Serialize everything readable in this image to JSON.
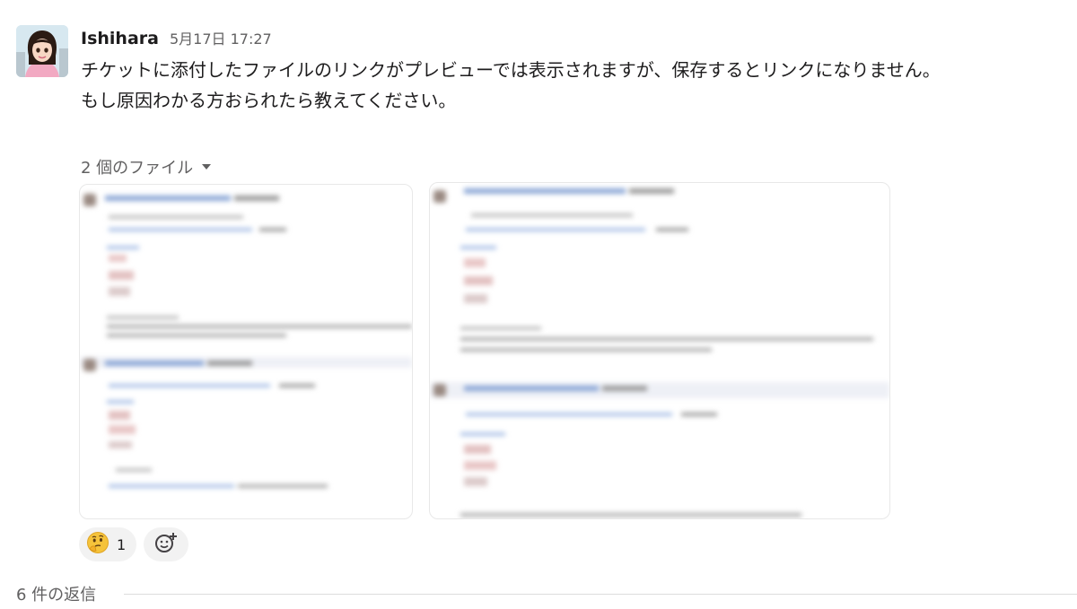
{
  "message": {
    "username": "Ishihara",
    "timestamp": "5月17日 17:27",
    "lines": [
      "チケットに添付したファイルのリンクがプレビューでは表示されますが、保存するとリンクになりません。",
      "もし原因わかる方おられたら教えてください。"
    ]
  },
  "files": {
    "label": "2 個のファイル",
    "icon": "caret-down-icon"
  },
  "reactions": [
    {
      "emoji": "🤔",
      "icon": "thinking-face-icon",
      "count": "1"
    }
  ],
  "add_reaction": {
    "icon": "add-reaction-icon"
  },
  "thread": {
    "replies_label": "6 件の返信"
  },
  "colors": {
    "text": "#1d1c1d",
    "muted": "#616061",
    "link_blue": "#1264a3",
    "reaction_bg": "#f2f2f2"
  }
}
